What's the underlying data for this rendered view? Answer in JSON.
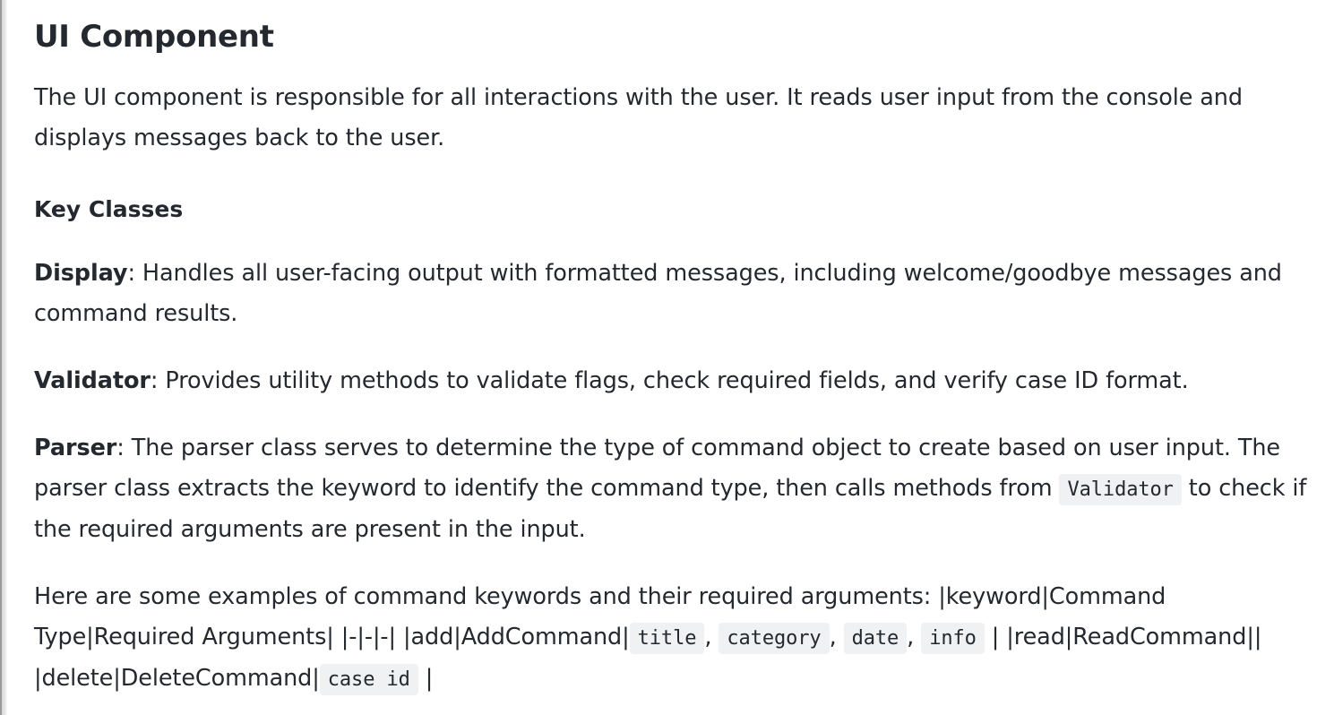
{
  "heading": "UI Component",
  "intro": "The UI component is responsible for all interactions with the user. It reads user input from the console and displays messages back to the user.",
  "key_classes_heading": "Key Classes",
  "display": {
    "name": "Display",
    "text": ": Handles all user-facing output with formatted messages, including welcome/goodbye messages and command results."
  },
  "validator": {
    "name": "Validator",
    "text": ": Provides utility methods to validate flags, check required fields, and verify case ID format."
  },
  "parser": {
    "name": "Parser",
    "text_before": ": The parser class serves to determine the type of command object to create based on user input. The parser class extracts the keyword to identify the command type, then calls methods from ",
    "code": "Validator",
    "text_after": " to check if the required arguments are present in the input."
  },
  "examples": {
    "text_1": "Here are some examples of command keywords and their required arguments: |keyword|Command Type|Required Arguments| |-|-|-| |add|AddCommand|",
    "code_title": "title",
    "sep_1": ", ",
    "code_category": "category",
    "sep_2": ", ",
    "code_date": "date",
    "sep_3": ", ",
    "code_info": "info",
    "text_2": " | |read|ReadCommand|| |delete|DeleteCommand|",
    "code_case_id": "case id",
    "text_3": " |"
  }
}
